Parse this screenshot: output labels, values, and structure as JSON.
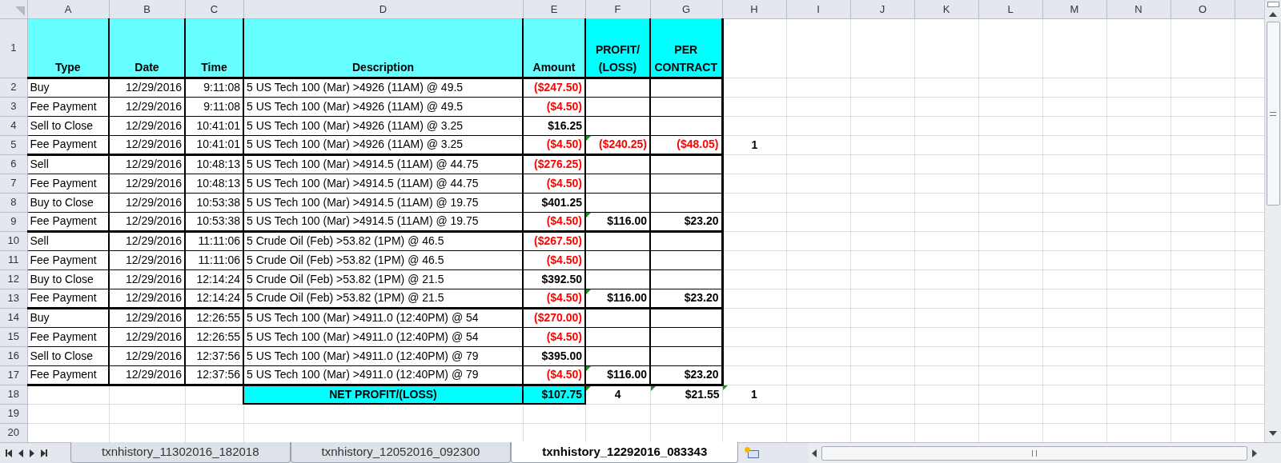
{
  "column_headers": [
    "A",
    "B",
    "C",
    "D",
    "E",
    "F",
    "G",
    "H",
    "I",
    "J",
    "K",
    "L",
    "M",
    "N",
    "O"
  ],
  "header_row": {
    "number": "1",
    "cells": [
      {
        "text": "Type",
        "color": "#66ffff"
      },
      {
        "text": "Date",
        "color": "#66ffff"
      },
      {
        "text": "Time",
        "color": "#66ffff"
      },
      {
        "text": "Description",
        "color": "#66ffff"
      },
      {
        "text": "Amount",
        "color": "#66ffff"
      },
      {
        "text": "PROFIT/\n(LOSS)",
        "color": "#00ffff"
      },
      {
        "text": "PER\nCONTRACT",
        "color": "#00ffff"
      }
    ]
  },
  "trades": [
    {
      "rows": [
        {
          "number": "2",
          "type": "Buy",
          "date": "12/29/2016",
          "time": "9:11:08",
          "description": "5 US Tech 100 (Mar) >4926 (11AM) @ 49.5",
          "amount": {
            "text": "($247.50)",
            "negative": true
          }
        },
        {
          "number": "3",
          "type": "Fee Payment",
          "date": "12/29/2016",
          "time": "9:11:08",
          "description": "5 US Tech 100 (Mar) >4926 (11AM) @ 49.5",
          "amount": {
            "text": "($4.50)",
            "negative": true
          }
        },
        {
          "number": "4",
          "type": "Sell to Close",
          "date": "12/29/2016",
          "time": "10:41:01",
          "description": "5 US Tech 100 (Mar) >4926 (11AM) @ 3.25",
          "amount": {
            "text": "$16.25",
            "negative": false
          }
        },
        {
          "number": "5",
          "type": "Fee Payment",
          "date": "12/29/2016",
          "time": "10:41:01",
          "description": "5 US Tech 100 (Mar) >4926 (11AM) @ 3.25",
          "amount": {
            "text": "($4.50)",
            "negative": true
          },
          "profit": {
            "text": "($240.25)",
            "negative": true,
            "flagged": true
          },
          "per_contract": {
            "text": "($48.05)",
            "negative": true,
            "flagged": false
          },
          "column_h": {
            "text": "1",
            "flagged": false
          }
        }
      ]
    },
    {
      "rows": [
        {
          "number": "6",
          "type": "Sell",
          "date": "12/29/2016",
          "time": "10:48:13",
          "description": "5 US Tech 100 (Mar) >4914.5 (11AM) @ 44.75",
          "amount": {
            "text": "($276.25)",
            "negative": true
          }
        },
        {
          "number": "7",
          "type": "Fee Payment",
          "date": "12/29/2016",
          "time": "10:48:13",
          "description": "5 US Tech 100 (Mar) >4914.5 (11AM) @ 44.75",
          "amount": {
            "text": "($4.50)",
            "negative": true
          }
        },
        {
          "number": "8",
          "type": "Buy to Close",
          "date": "12/29/2016",
          "time": "10:53:38",
          "description": "5 US Tech 100 (Mar) >4914.5 (11AM) @ 19.75",
          "amount": {
            "text": "$401.25",
            "negative": false
          }
        },
        {
          "number": "9",
          "type": "Fee Payment",
          "date": "12/29/2016",
          "time": "10:53:38",
          "description": "5 US Tech 100 (Mar) >4914.5 (11AM) @ 19.75",
          "amount": {
            "text": "($4.50)",
            "negative": true
          },
          "profit": {
            "text": "$116.00",
            "negative": false,
            "flagged": true
          },
          "per_contract": {
            "text": "$23.20",
            "negative": false,
            "flagged": false
          }
        }
      ]
    },
    {
      "rows": [
        {
          "number": "10",
          "type": "Sell",
          "date": "12/29/2016",
          "time": "11:11:06",
          "description": "5 Crude Oil (Feb) >53.82 (1PM) @ 46.5",
          "amount": {
            "text": "($267.50)",
            "negative": true
          }
        },
        {
          "number": "11",
          "type": "Fee Payment",
          "date": "12/29/2016",
          "time": "11:11:06",
          "description": "5 Crude Oil (Feb) >53.82 (1PM) @ 46.5",
          "amount": {
            "text": "($4.50)",
            "negative": true
          }
        },
        {
          "number": "12",
          "type": "Buy to Close",
          "date": "12/29/2016",
          "time": "12:14:24",
          "description": "5 Crude Oil (Feb) >53.82 (1PM) @ 21.5",
          "amount": {
            "text": "$392.50",
            "negative": false
          }
        },
        {
          "number": "13",
          "type": "Fee Payment",
          "date": "12/29/2016",
          "time": "12:14:24",
          "description": "5 Crude Oil (Feb) >53.82 (1PM) @ 21.5",
          "amount": {
            "text": "($4.50)",
            "negative": true
          },
          "profit": {
            "text": "$116.00",
            "negative": false,
            "flagged": true
          },
          "per_contract": {
            "text": "$23.20",
            "negative": false,
            "flagged": false
          }
        }
      ]
    },
    {
      "rows": [
        {
          "number": "14",
          "type": "Buy",
          "date": "12/29/2016",
          "time": "12:26:55",
          "description": "5 US Tech 100 (Mar) >4911.0 (12:40PM) @ 54",
          "amount": {
            "text": "($270.00)",
            "negative": true
          }
        },
        {
          "number": "15",
          "type": "Fee Payment",
          "date": "12/29/2016",
          "time": "12:26:55",
          "description": "5 US Tech 100 (Mar) >4911.0 (12:40PM) @ 54",
          "amount": {
            "text": "($4.50)",
            "negative": true
          }
        },
        {
          "number": "16",
          "type": "Sell to Close",
          "date": "12/29/2016",
          "time": "12:37:56",
          "description": "5 US Tech 100 (Mar) >4911.0 (12:40PM) @ 79",
          "amount": {
            "text": "$395.00",
            "negative": false
          }
        },
        {
          "number": "17",
          "type": "Fee Payment",
          "date": "12/29/2016",
          "time": "12:37:56",
          "description": "5 US Tech 100 (Mar) >4911.0 (12:40PM) @ 79",
          "amount": {
            "text": "($4.50)",
            "negative": true
          },
          "profit": {
            "text": "$116.00",
            "negative": false,
            "flagged": true
          },
          "per_contract": {
            "text": "$23.20",
            "negative": false,
            "flagged": false
          }
        }
      ]
    }
  ],
  "total": {
    "number": "18",
    "label": "NET PROFIT/(LOSS)",
    "amount": "$107.75",
    "count": {
      "text": "4",
      "flagged": true
    },
    "per_contract": {
      "text": "$21.55",
      "flagged": true
    },
    "column_h": {
      "text": "1",
      "flagged": true
    }
  },
  "empty_rows": [
    "19",
    "20"
  ],
  "sheet_tabs": [
    {
      "label": "txnhistory_11302016_182018",
      "selected": false
    },
    {
      "label": "txnhistory_12052016_092300",
      "selected": false
    },
    {
      "label": "txnhistory_12292016_083343",
      "selected": true
    }
  ]
}
